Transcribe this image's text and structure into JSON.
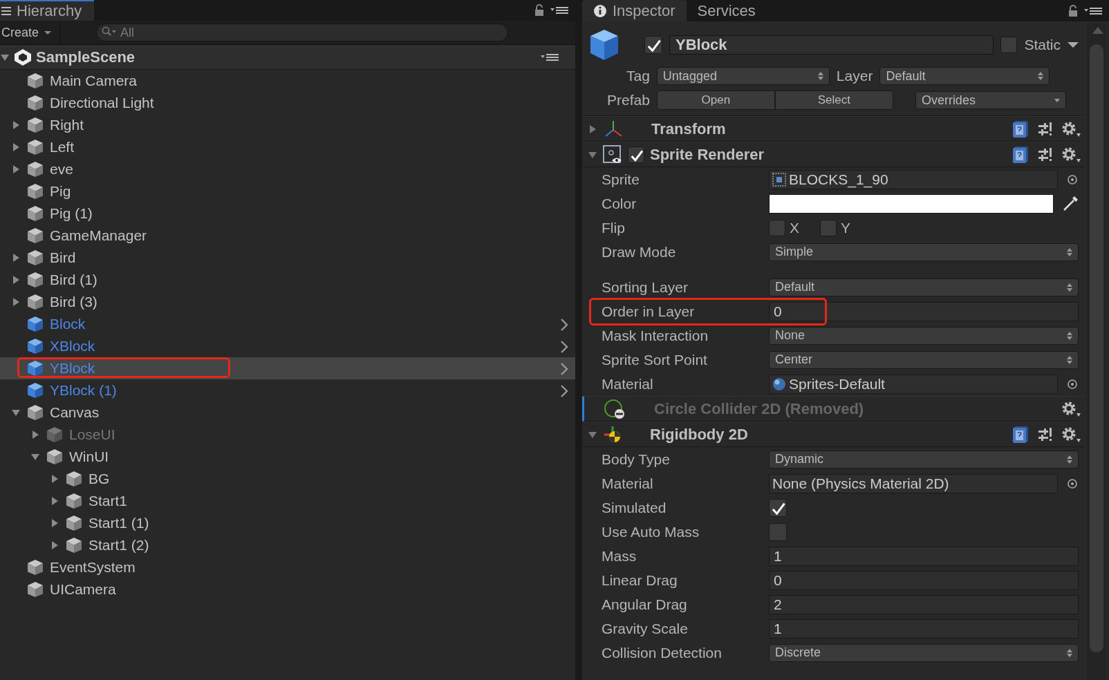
{
  "hierarchy": {
    "tab": "Hierarchy",
    "create": "Create",
    "search_placeholder": "All",
    "scene": {
      "name": "SampleScene",
      "expanded": true
    },
    "items": [
      {
        "label": "Main Camera",
        "kind": "object",
        "selected": false
      },
      {
        "label": "Directional Light",
        "kind": "object",
        "selected": false
      },
      {
        "label": "Right",
        "kind": "object",
        "selected": false,
        "expanded": false,
        "children_hidden": true
      },
      {
        "label": "Left",
        "kind": "object",
        "selected": false,
        "expanded": false,
        "children_hidden": true
      },
      {
        "label": "eve",
        "kind": "object",
        "selected": false,
        "expanded": false,
        "children_hidden": true
      },
      {
        "label": "Pig",
        "kind": "object",
        "selected": false
      },
      {
        "label": "Pig (1)",
        "kind": "object",
        "selected": false
      },
      {
        "label": "GameManager",
        "kind": "object",
        "selected": false
      },
      {
        "label": "Bird",
        "kind": "object",
        "selected": false,
        "expanded": false,
        "children_hidden": true
      },
      {
        "label": "Bird (1)",
        "kind": "object",
        "selected": false,
        "expanded": false,
        "children_hidden": true
      },
      {
        "label": "Bird (3)",
        "kind": "object",
        "selected": false,
        "expanded": false,
        "children_hidden": true
      },
      {
        "label": "Block",
        "kind": "prefab",
        "selected": false
      },
      {
        "label": "XBlock",
        "kind": "prefab",
        "selected": false
      },
      {
        "label": "YBlock",
        "kind": "prefab",
        "selected": true,
        "highlighted": true
      },
      {
        "label": "YBlock (1)",
        "kind": "prefab",
        "selected": false
      },
      {
        "label": "Canvas",
        "kind": "object",
        "selected": false,
        "expanded": true,
        "children": [
          {
            "label": "LoseUI",
            "kind": "object",
            "selected": false,
            "disabled": true,
            "expanded": false,
            "children_hidden": true
          },
          {
            "label": "WinUI",
            "kind": "object",
            "selected": false,
            "expanded": true,
            "children": [
              {
                "label": "BG",
                "kind": "object",
                "selected": false,
                "expanded": false,
                "children_hidden": true
              },
              {
                "label": "Start1",
                "kind": "object",
                "selected": false,
                "expanded": false,
                "children_hidden": true
              },
              {
                "label": "Start1 (1)",
                "kind": "object",
                "selected": false,
                "expanded": false,
                "children_hidden": true
              },
              {
                "label": "Start1 (2)",
                "kind": "object",
                "selected": false,
                "expanded": false,
                "children_hidden": true
              }
            ]
          }
        ]
      },
      {
        "label": "EventSystem",
        "kind": "object",
        "selected": false
      },
      {
        "label": "UICamera",
        "kind": "object",
        "selected": false
      }
    ]
  },
  "inspector": {
    "tabs": [
      {
        "label": "Inspector",
        "selected": true
      },
      {
        "label": "Services",
        "selected": false
      }
    ],
    "object": {
      "active": true,
      "name": "YBlock",
      "static_label": "Static",
      "static": false,
      "tag_label": "Tag",
      "tag": "Untagged",
      "layer_label": "Layer",
      "layer": "Default",
      "prefab_label": "Prefab",
      "prefab_buttons": [
        "Open",
        "Select"
      ],
      "overrides": "Overrides"
    },
    "components": [
      {
        "name": "Transform",
        "kind": "transform",
        "expanded": false
      },
      {
        "name": "Sprite Renderer",
        "kind": "sprite_renderer",
        "expanded": true,
        "enabled": true,
        "properties": [
          {
            "label": "Sprite",
            "kind": "sprite",
            "value": "BLOCKS_1_90"
          },
          {
            "label": "Color",
            "kind": "color",
            "color": "#ffffff"
          },
          {
            "label": "Flip",
            "kind": "flip",
            "options": [
              {
                "label": "X",
                "checked": false
              },
              {
                "label": "Y",
                "checked": false
              }
            ]
          },
          {
            "label": "Draw Mode",
            "kind": "dropdown",
            "value": "Simple"
          },
          {
            "label": "Sorting Layer",
            "kind": "dropdown",
            "value": "Default",
            "separated": true
          },
          {
            "label": "Order in Layer",
            "kind": "number",
            "value": "0",
            "highlighted": true
          },
          {
            "label": "Mask Interaction",
            "kind": "dropdown",
            "value": "None"
          },
          {
            "label": "Sprite Sort Point",
            "kind": "dropdown",
            "value": "Center"
          },
          {
            "label": "Material",
            "kind": "material",
            "value": "Sprites-Default"
          }
        ]
      },
      {
        "name": "Circle Collider 2D (Removed)",
        "kind": "circle_collider",
        "removed": true
      },
      {
        "name": "Rigidbody 2D",
        "kind": "rigidbody",
        "expanded": true,
        "properties": [
          {
            "label": "Body Type",
            "kind": "dropdown",
            "value": "Dynamic"
          },
          {
            "label": "Material",
            "kind": "object",
            "value": "None (Physics Material 2D)"
          },
          {
            "label": "Simulated",
            "kind": "checkbox",
            "checked": true
          },
          {
            "label": "Use Auto Mass",
            "kind": "checkbox",
            "checked": false
          },
          {
            "label": "Mass",
            "kind": "number",
            "value": "1"
          },
          {
            "label": "Linear Drag",
            "kind": "number",
            "value": "0"
          },
          {
            "label": "Angular Drag",
            "kind": "number",
            "value": "2"
          },
          {
            "label": "Gravity Scale",
            "kind": "number",
            "value": "1"
          },
          {
            "label": "Collision Detection",
            "kind": "dropdown",
            "value": "Discrete"
          }
        ]
      }
    ]
  }
}
